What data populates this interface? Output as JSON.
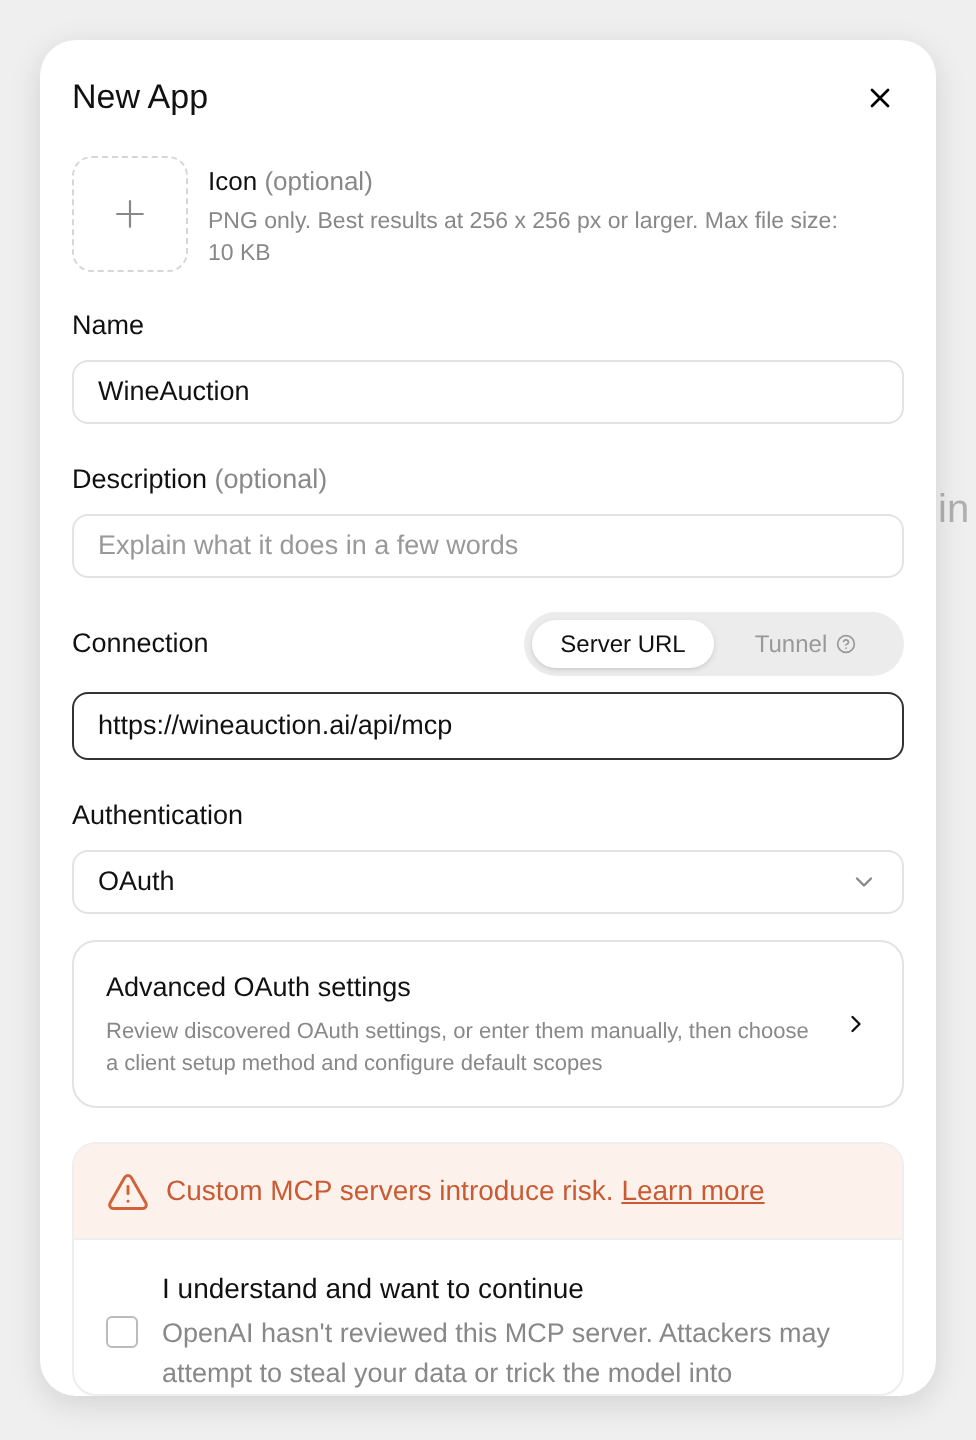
{
  "background_text": "in",
  "dialog": {
    "title": "New App",
    "icon_upload": {
      "label": "Icon",
      "optional": "(optional)",
      "hint": "PNG only. Best results at 256 x 256 px or larger. Max file size: 10 KB"
    },
    "name": {
      "label": "Name",
      "value": "WineAuction"
    },
    "description": {
      "label": "Description",
      "optional": "(optional)",
      "placeholder": "Explain what it does in a few words"
    },
    "connection": {
      "label": "Connection",
      "tabs": [
        {
          "label": "Server URL",
          "selected": true
        },
        {
          "label": "Tunnel",
          "selected": false
        }
      ],
      "value": "https://wineauction.ai/api/mcp"
    },
    "authentication": {
      "label": "Authentication",
      "value": "OAuth"
    },
    "advanced": {
      "title": "Advanced OAuth settings",
      "text": "Review discovered OAuth settings, or enter them manually, then choose a client setup method and configure default scopes"
    },
    "warning": {
      "text": "Custom MCP servers introduce risk.",
      "link": "Learn more"
    },
    "consent": {
      "label": "I understand and want to continue",
      "text": "OpenAI hasn't reviewed this MCP server. Attackers may attempt to steal your data or trick the model into",
      "checked": false
    }
  }
}
